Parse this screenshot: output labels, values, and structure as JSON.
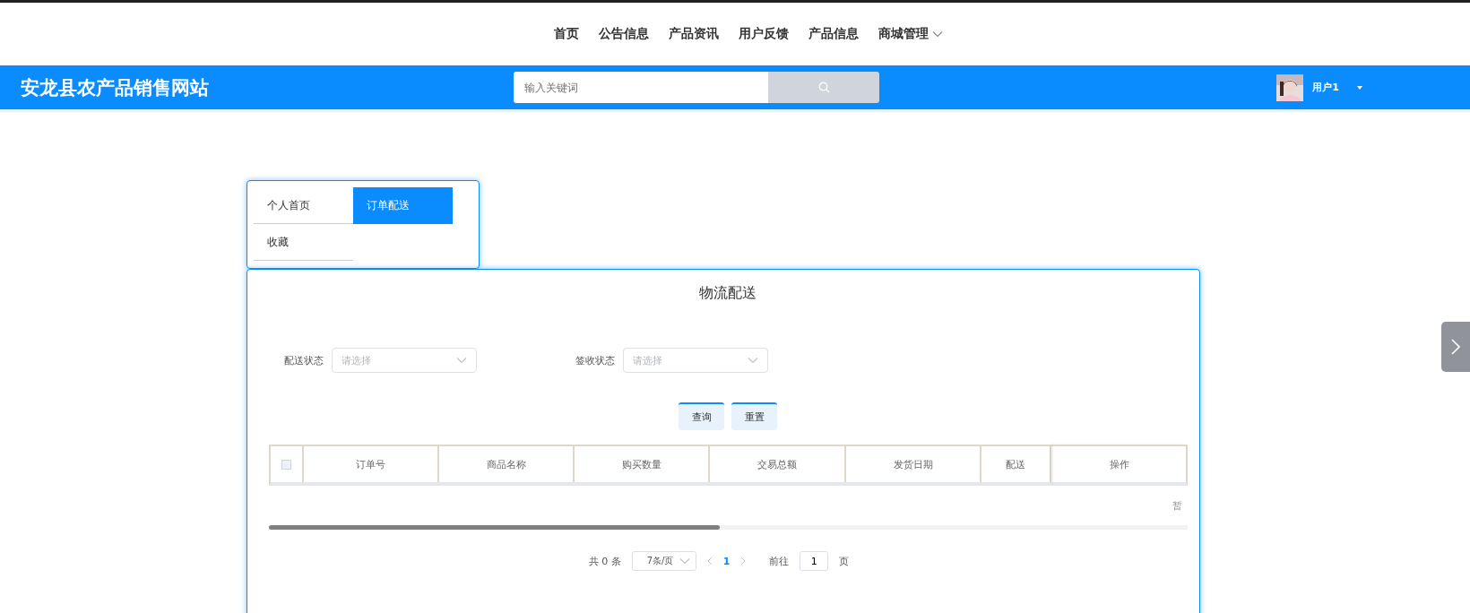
{
  "top_nav": {
    "items": [
      {
        "label": "首页",
        "dropdown": false
      },
      {
        "label": "公告信息",
        "dropdown": false
      },
      {
        "label": "产品资讯",
        "dropdown": false
      },
      {
        "label": "用户反馈",
        "dropdown": false
      },
      {
        "label": "产品信息",
        "dropdown": false
      },
      {
        "label": "商城管理",
        "dropdown": true
      }
    ]
  },
  "header": {
    "site_title": "安龙县农产品销售网站",
    "search": {
      "placeholder": "输入关键词"
    },
    "user": {
      "name": "用户1"
    }
  },
  "side_menu": {
    "items": [
      {
        "label": "个人首页",
        "selected": false
      },
      {
        "label": "订单配送",
        "selected": true
      },
      {
        "label": "收藏",
        "selected": false
      }
    ]
  },
  "panel": {
    "title": "物流配送",
    "filters": [
      {
        "label": "配送状态",
        "placeholder": "请选择"
      },
      {
        "label": "签收状态",
        "placeholder": "请选择"
      }
    ],
    "buttons": [
      "查询",
      "重置"
    ],
    "table": {
      "select_all_checked": false,
      "columns": [
        "订单号",
        "商品名称",
        "购买数量",
        "交易总额",
        "发货日期",
        "配送"
      ],
      "fixed_column": "操作",
      "empty_text": "暂"
    },
    "pagination": {
      "total": "共 0 条",
      "page_size": "7条/页",
      "pages": [
        {
          "label": "1",
          "selected": true
        }
      ],
      "goto_label": "前往",
      "goto_value": "1",
      "goto_suffix": "页"
    }
  }
}
